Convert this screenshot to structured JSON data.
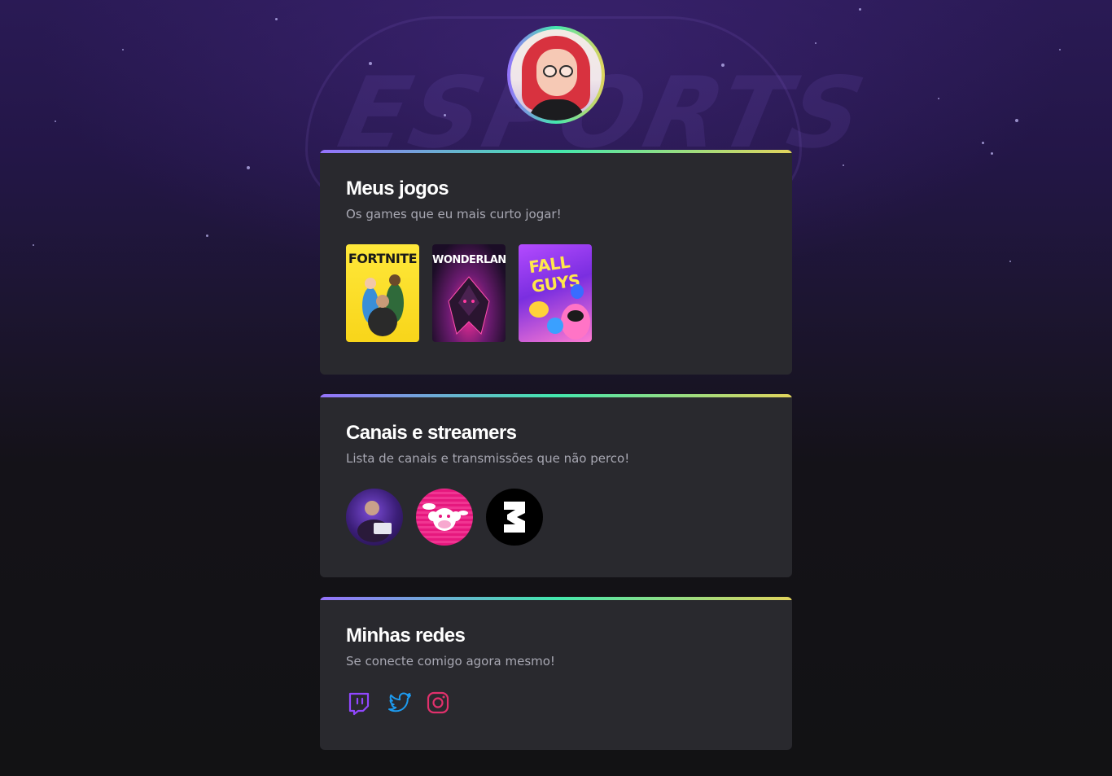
{
  "profile": {
    "avatar_alt": "avatar"
  },
  "colors": {
    "accent_gradient": [
      "#9572fc",
      "#43e7ad",
      "#e2d45c"
    ],
    "card_bg": "#29292e",
    "page_bg": "#121214",
    "twitch": "#9147ff",
    "twitter": "#1d9bf0",
    "instagram": "#e1306c"
  },
  "cards": {
    "games": {
      "title": "Meus jogos",
      "subtitle": "Os games que eu mais curto jogar!",
      "items": [
        {
          "name": "FORTNITE",
          "icon": "fortnite-cover"
        },
        {
          "name": "WONDERLANDS",
          "icon": "wonderlands-cover"
        },
        {
          "name": "FALL GUYS",
          "icon": "fall-guys-cover"
        }
      ]
    },
    "channels": {
      "title": "Canais e streamers",
      "subtitle": "Lista de canais e transmissões que não perco!",
      "items": [
        {
          "icon": "streamer-avatar"
        },
        {
          "icon": "monkey-logo"
        },
        {
          "icon": "channel-logo"
        }
      ]
    },
    "social": {
      "title": "Minhas redes",
      "subtitle": "Se conecte comigo agora mesmo!",
      "items": [
        {
          "icon": "twitch-icon"
        },
        {
          "icon": "twitter-icon"
        },
        {
          "icon": "instagram-icon"
        }
      ]
    }
  }
}
